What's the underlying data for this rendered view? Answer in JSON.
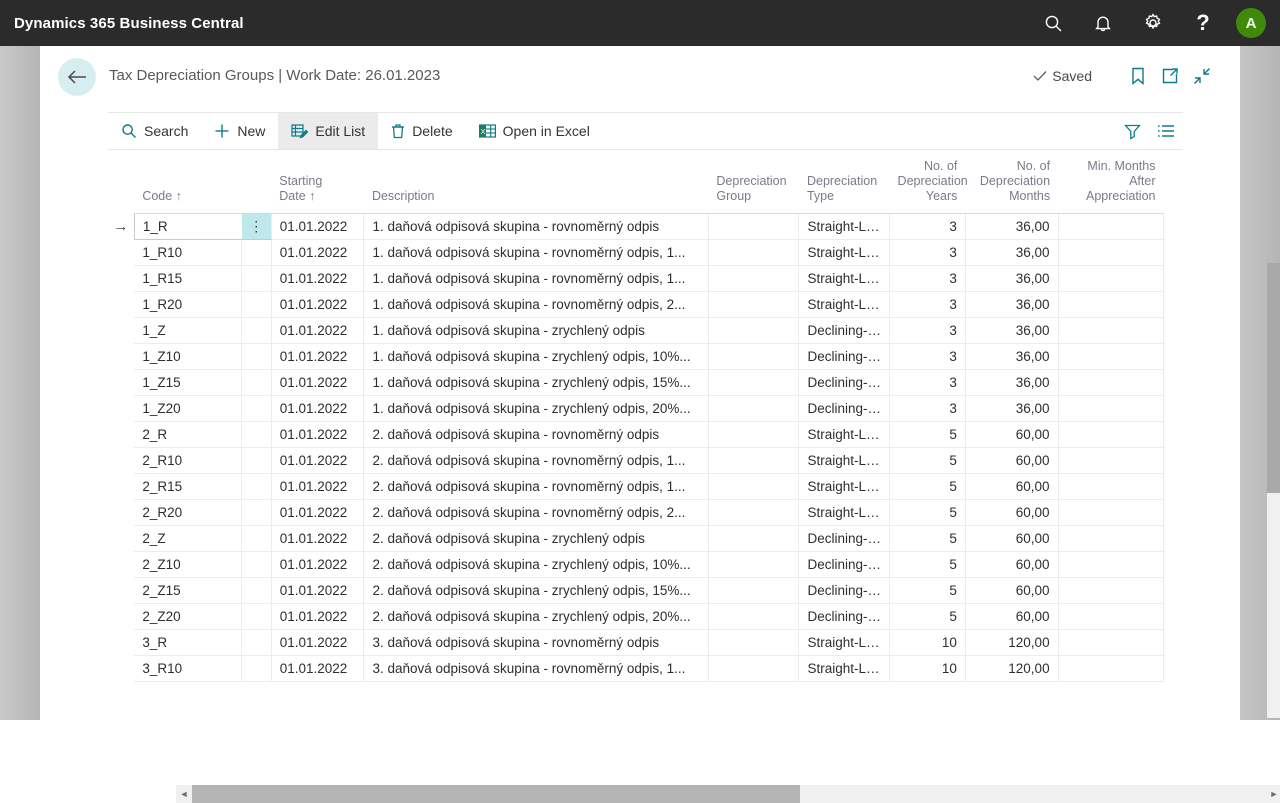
{
  "appbar": {
    "title": "Dynamics 365 Business Central",
    "icons": [
      {
        "name": "search-icon",
        "label": "Search"
      },
      {
        "name": "notification-bell-icon",
        "label": "Notifications"
      },
      {
        "name": "gear-icon",
        "label": "Settings"
      },
      {
        "name": "help-icon",
        "label": "?"
      }
    ],
    "avatar_initial": "A",
    "bg_color": "#2b2b2b",
    "avatar_color": "#3f8a0b"
  },
  "header": {
    "back_label": "Back",
    "title": "Tax Depreciation Groups | Work Date: 26.01.2023",
    "saved_label": "Saved",
    "actions": [
      {
        "name": "bookmark-icon",
        "label": "Bookmark"
      },
      {
        "name": "open-in-new-window-icon",
        "label": "Open in new window"
      },
      {
        "name": "collapse-icon",
        "label": "Collapse"
      }
    ]
  },
  "toolbar": {
    "buttons": [
      {
        "name": "search-button",
        "label": "Search",
        "icon": "search-icon",
        "active": false
      },
      {
        "name": "new-button",
        "label": "New",
        "icon": "plus-icon",
        "active": false
      },
      {
        "name": "edit-list-button",
        "label": "Edit List",
        "icon": "edit-list-icon",
        "active": true
      },
      {
        "name": "delete-button",
        "label": "Delete",
        "icon": "trash-icon",
        "active": false
      },
      {
        "name": "open-in-excel-button",
        "label": "Open in Excel",
        "icon": "excel-icon",
        "active": false
      }
    ],
    "right_icons": [
      {
        "name": "filter-icon",
        "label": "Filter"
      },
      {
        "name": "list-view-icon",
        "label": "Choose columns"
      }
    ],
    "accent_color": "#0f7a8a"
  },
  "grid": {
    "columns": [
      {
        "key": "code",
        "label": "Code ↑",
        "align": "left"
      },
      {
        "key": "starting_date",
        "label": "Starting\nDate ↑",
        "align": "left"
      },
      {
        "key": "description",
        "label": "Description",
        "align": "left"
      },
      {
        "key": "depreciation_group",
        "label": "Depreciation\nGroup",
        "align": "left"
      },
      {
        "key": "depreciation_type",
        "label": "Depreciation\nType",
        "align": "left"
      },
      {
        "key": "no_of_depreciation_years",
        "label": "No. of\nDepreciation\nYears",
        "align": "right"
      },
      {
        "key": "no_of_depreciation_months",
        "label": "No. of\nDepreciation\nMonths",
        "align": "right"
      },
      {
        "key": "min_months_after_appreciation",
        "label": "Min. Months\nAfter\nAppreciation",
        "align": "right"
      }
    ],
    "selected_row_index": 0,
    "rows": [
      {
        "code": "1_R",
        "starting_date": "01.01.2022",
        "description": "1. daňová odpisová skupina - rovnoměrný odpis",
        "depreciation_group": "",
        "depreciation_type": "Straight-Line",
        "no_of_depreciation_years": "3",
        "no_of_depreciation_months": "36,00",
        "min_months_after_appreciation": ""
      },
      {
        "code": "1_R10",
        "starting_date": "01.01.2022",
        "description": "1. daňová odpisová skupina - rovnoměrný odpis, 1...",
        "depreciation_group": "",
        "depreciation_type": "Straight-Line",
        "no_of_depreciation_years": "3",
        "no_of_depreciation_months": "36,00",
        "min_months_after_appreciation": ""
      },
      {
        "code": "1_R15",
        "starting_date": "01.01.2022",
        "description": "1. daňová odpisová skupina - rovnoměrný odpis, 1...",
        "depreciation_group": "",
        "depreciation_type": "Straight-Line",
        "no_of_depreciation_years": "3",
        "no_of_depreciation_months": "36,00",
        "min_months_after_appreciation": ""
      },
      {
        "code": "1_R20",
        "starting_date": "01.01.2022",
        "description": "1. daňová odpisová skupina - rovnoměrný odpis, 2...",
        "depreciation_group": "",
        "depreciation_type": "Straight-Line",
        "no_of_depreciation_years": "3",
        "no_of_depreciation_months": "36,00",
        "min_months_after_appreciation": ""
      },
      {
        "code": "1_Z",
        "starting_date": "01.01.2022",
        "description": "1. daňová odpisová skupina - zrychlený odpis",
        "depreciation_group": "",
        "depreciation_type": "Declining-B...",
        "no_of_depreciation_years": "3",
        "no_of_depreciation_months": "36,00",
        "min_months_after_appreciation": ""
      },
      {
        "code": "1_Z10",
        "starting_date": "01.01.2022",
        "description": "1. daňová odpisová skupina - zrychlený odpis, 10%...",
        "depreciation_group": "",
        "depreciation_type": "Declining-B...",
        "no_of_depreciation_years": "3",
        "no_of_depreciation_months": "36,00",
        "min_months_after_appreciation": ""
      },
      {
        "code": "1_Z15",
        "starting_date": "01.01.2022",
        "description": "1. daňová odpisová skupina - zrychlený odpis, 15%...",
        "depreciation_group": "",
        "depreciation_type": "Declining-B...",
        "no_of_depreciation_years": "3",
        "no_of_depreciation_months": "36,00",
        "min_months_after_appreciation": ""
      },
      {
        "code": "1_Z20",
        "starting_date": "01.01.2022",
        "description": "1. daňová odpisová skupina - zrychlený odpis, 20%...",
        "depreciation_group": "",
        "depreciation_type": "Declining-B...",
        "no_of_depreciation_years": "3",
        "no_of_depreciation_months": "36,00",
        "min_months_after_appreciation": ""
      },
      {
        "code": "2_R",
        "starting_date": "01.01.2022",
        "description": "2. daňová odpisová skupina - rovnoměrný odpis",
        "depreciation_group": "",
        "depreciation_type": "Straight-Line",
        "no_of_depreciation_years": "5",
        "no_of_depreciation_months": "60,00",
        "min_months_after_appreciation": ""
      },
      {
        "code": "2_R10",
        "starting_date": "01.01.2022",
        "description": "2. daňová odpisová skupina - rovnoměrný odpis, 1...",
        "depreciation_group": "",
        "depreciation_type": "Straight-Line",
        "no_of_depreciation_years": "5",
        "no_of_depreciation_months": "60,00",
        "min_months_after_appreciation": ""
      },
      {
        "code": "2_R15",
        "starting_date": "01.01.2022",
        "description": "2. daňová odpisová skupina - rovnoměrný odpis, 1...",
        "depreciation_group": "",
        "depreciation_type": "Straight-Line",
        "no_of_depreciation_years": "5",
        "no_of_depreciation_months": "60,00",
        "min_months_after_appreciation": ""
      },
      {
        "code": "2_R20",
        "starting_date": "01.01.2022",
        "description": "2. daňová odpisová skupina - rovnoměrný odpis, 2...",
        "depreciation_group": "",
        "depreciation_type": "Straight-Line",
        "no_of_depreciation_years": "5",
        "no_of_depreciation_months": "60,00",
        "min_months_after_appreciation": ""
      },
      {
        "code": "2_Z",
        "starting_date": "01.01.2022",
        "description": "2. daňová odpisová skupina - zrychlený odpis",
        "depreciation_group": "",
        "depreciation_type": "Declining-B...",
        "no_of_depreciation_years": "5",
        "no_of_depreciation_months": "60,00",
        "min_months_after_appreciation": ""
      },
      {
        "code": "2_Z10",
        "starting_date": "01.01.2022",
        "description": "2. daňová odpisová skupina - zrychlený odpis, 10%...",
        "depreciation_group": "",
        "depreciation_type": "Declining-B...",
        "no_of_depreciation_years": "5",
        "no_of_depreciation_months": "60,00",
        "min_months_after_appreciation": ""
      },
      {
        "code": "2_Z15",
        "starting_date": "01.01.2022",
        "description": "2. daňová odpisová skupina - zrychlený odpis, 15%...",
        "depreciation_group": "",
        "depreciation_type": "Declining-B...",
        "no_of_depreciation_years": "5",
        "no_of_depreciation_months": "60,00",
        "min_months_after_appreciation": ""
      },
      {
        "code": "2_Z20",
        "starting_date": "01.01.2022",
        "description": "2. daňová odpisová skupina - zrychlený odpis, 20%...",
        "depreciation_group": "",
        "depreciation_type": "Declining-B...",
        "no_of_depreciation_years": "5",
        "no_of_depreciation_months": "60,00",
        "min_months_after_appreciation": ""
      },
      {
        "code": "3_R",
        "starting_date": "01.01.2022",
        "description": "3. daňová odpisová skupina - rovnoměrný odpis",
        "depreciation_group": "",
        "depreciation_type": "Straight-Line",
        "no_of_depreciation_years": "10",
        "no_of_depreciation_months": "120,00",
        "min_months_after_appreciation": ""
      },
      {
        "code": "3_R10",
        "starting_date": "01.01.2022",
        "description": "3. daňová odpisová skupina - rovnoměrný odpis, 1...",
        "depreciation_group": "",
        "depreciation_type": "Straight-Line",
        "no_of_depreciation_years": "10",
        "no_of_depreciation_months": "120,00",
        "min_months_after_appreciation": ""
      }
    ],
    "row_indicator": "→",
    "row_menu_glyph": "⋮",
    "selected_cell_color": "#bfe8ec"
  },
  "scrollbars": {
    "vertical_name": "vertical-scrollbar",
    "horizontal_name": "horizontal-scrollbar",
    "left_arrow": "◄",
    "right_arrow": "►"
  }
}
